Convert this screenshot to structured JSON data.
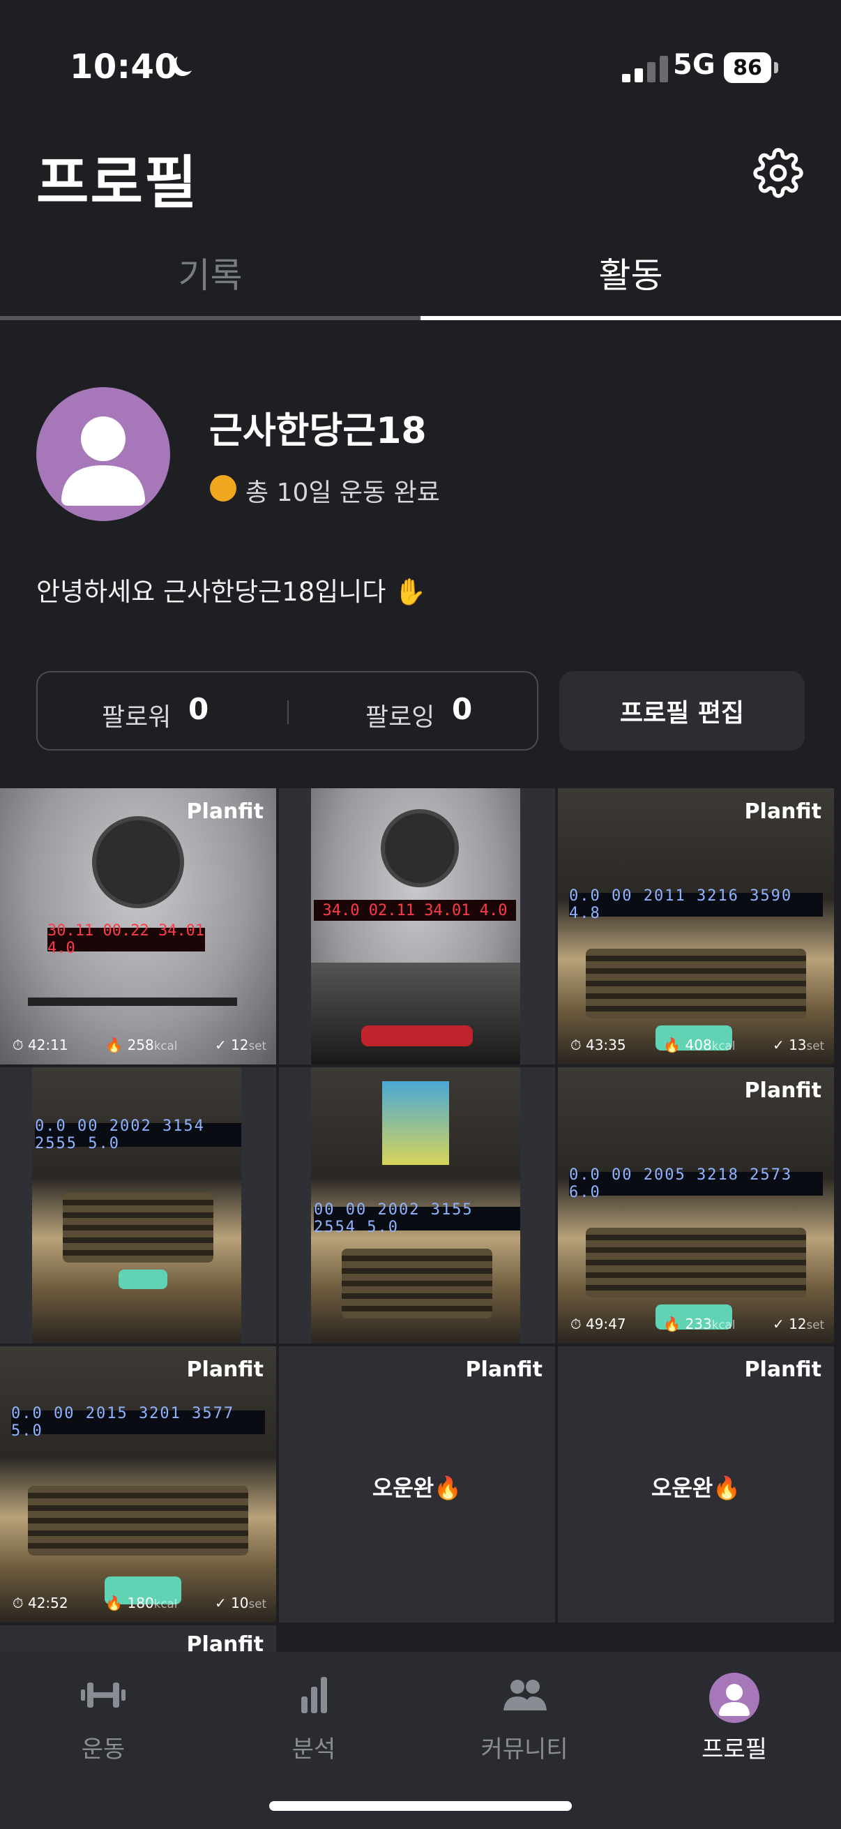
{
  "status_bar": {
    "time": "10:40",
    "network": "5G",
    "battery": "86"
  },
  "header": {
    "title": "프로필"
  },
  "tabs": [
    {
      "label": "기록"
    },
    {
      "label": "활동"
    }
  ],
  "profile": {
    "nickname": "근사한당근18",
    "workout_summary": "총 10일 운동 완료",
    "bio": "안녕하세요 근사한당근18입니다 ✋"
  },
  "follow": {
    "followers_label": "팔로워",
    "followers_count": "0",
    "following_label": "팔로잉",
    "following_count": "0",
    "edit_label": "프로필 편집"
  },
  "feed": {
    "brand": "Planfit",
    "posts": [
      {
        "time": "42:11",
        "kcal": "258",
        "kcal_unit": "kcal",
        "sets": "12",
        "set_unit": "set",
        "display": "30.11  00.22  34.01  4.0"
      },
      {
        "display": "34.0  02.11  34.01  4.0"
      },
      {
        "time": "43:35",
        "kcal": "408",
        "kcal_unit": "kcal",
        "sets": "13",
        "set_unit": "set",
        "display": "0.0 00 2011 3216 3590 4.8"
      },
      {
        "display": "0.0 00 2002 3154 2555 5.0"
      },
      {
        "display": "00 00 2002 3155 2554 5.0"
      },
      {
        "time": "49:47",
        "kcal": "233",
        "kcal_unit": "kcal",
        "sets": "12",
        "set_unit": "set",
        "display": "0.0 00 2005 3218 2573 6.0"
      },
      {
        "time": "42:52",
        "kcal": "180",
        "kcal_unit": "kcal",
        "sets": "10",
        "set_unit": "set",
        "display": "0.0 00 2015 3201 3577 5.0"
      },
      {
        "text": "오운완🔥"
      },
      {
        "text": "오운완🔥"
      }
    ]
  },
  "bottom_nav": [
    {
      "label": "운동"
    },
    {
      "label": "분석"
    },
    {
      "label": "커뮤니티"
    },
    {
      "label": "프로필"
    }
  ],
  "colors": {
    "background": "#1e1f23",
    "avatar": "#a678ba",
    "badge_dot": "#f0a81e",
    "active_tab": "#ffffff"
  }
}
